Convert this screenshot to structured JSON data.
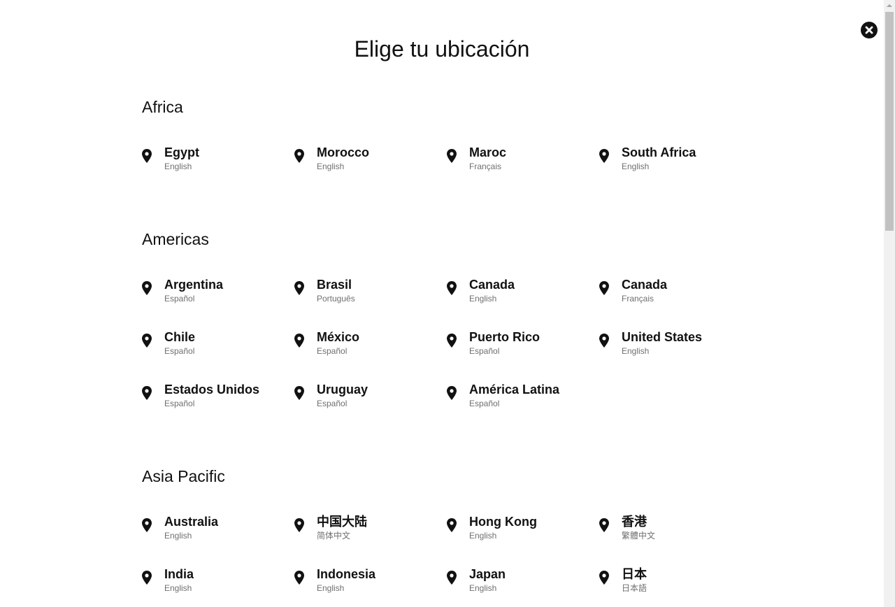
{
  "title": "Elige tu ubicación",
  "regions": [
    {
      "name": "Africa",
      "locations": [
        {
          "country": "Egypt",
          "language": "English"
        },
        {
          "country": "Morocco",
          "language": "English"
        },
        {
          "country": "Maroc",
          "language": "Français"
        },
        {
          "country": "South Africa",
          "language": "English"
        }
      ]
    },
    {
      "name": "Americas",
      "locations": [
        {
          "country": "Argentina",
          "language": "Español"
        },
        {
          "country": "Brasil",
          "language": "Português"
        },
        {
          "country": "Canada",
          "language": "English"
        },
        {
          "country": "Canada",
          "language": "Français"
        },
        {
          "country": "Chile",
          "language": "Español"
        },
        {
          "country": "México",
          "language": "Español"
        },
        {
          "country": "Puerto Rico",
          "language": "Español"
        },
        {
          "country": "United States",
          "language": "English"
        },
        {
          "country": "Estados Unidos",
          "language": "Español"
        },
        {
          "country": "Uruguay",
          "language": "Español"
        },
        {
          "country": "América Latina",
          "language": "Español"
        }
      ]
    },
    {
      "name": "Asia Pacific",
      "locations": [
        {
          "country": "Australia",
          "language": "English"
        },
        {
          "country": "中国大陆",
          "language": "简体中文"
        },
        {
          "country": "Hong Kong",
          "language": "English"
        },
        {
          "country": "香港",
          "language": "繁體中文"
        },
        {
          "country": "India",
          "language": "English"
        },
        {
          "country": "Indonesia",
          "language": "English"
        },
        {
          "country": "Japan",
          "language": "English"
        },
        {
          "country": "日本",
          "language": "日本語"
        }
      ]
    }
  ],
  "icons": {
    "close": "close-icon",
    "location": "map-pin-icon"
  },
  "colors": {
    "text": "#111111",
    "secondary_text": "#6f6f6f",
    "background": "#ffffff"
  }
}
